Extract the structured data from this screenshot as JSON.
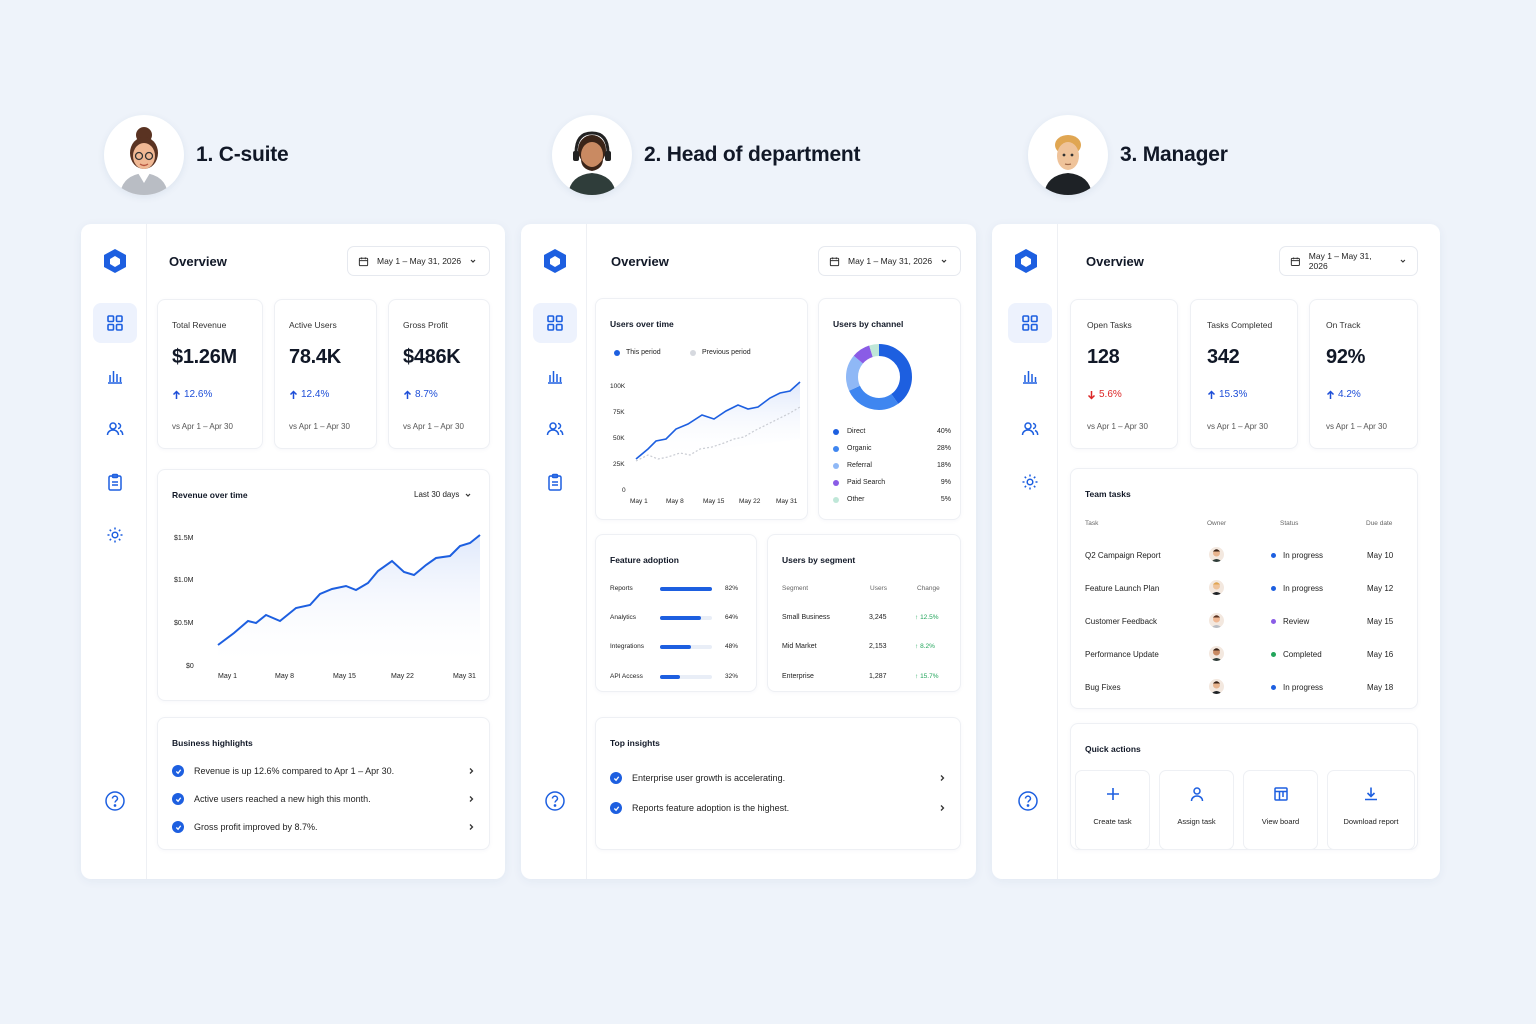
{
  "personas": [
    {
      "title": "1. C-suite"
    },
    {
      "title": "2. Head of department"
    },
    {
      "title": "3. Manager"
    }
  ],
  "csuite": {
    "overview": "Overview",
    "date_range": "May 1 – May 31, 2026",
    "kpis": [
      {
        "label": "Total Revenue",
        "value": "$1.26M",
        "change": "12.6%",
        "compare": "vs Apr 1 – Apr 30"
      },
      {
        "label": "Active Users",
        "value": "78.4K",
        "change": "12.4%",
        "compare": "vs Apr 1 – Apr 30"
      },
      {
        "label": "Gross Profit",
        "value": "$486K",
        "change": "8.7%",
        "compare": "vs Apr 1 – Apr 30"
      }
    ],
    "revenue_chart": {
      "title": "Revenue over time",
      "range_label": "Last 30 days",
      "y_ticks": [
        "$1.5M",
        "$1.0M",
        "$0.5M",
        "$0"
      ],
      "x_ticks": [
        "May 1",
        "May 8",
        "May 15",
        "May 22",
        "May 31"
      ]
    },
    "highlights": {
      "title": "Business highlights",
      "items": [
        "Revenue is up 12.6% compared to Apr 1 – Apr 30.",
        "Active users reached a new high this month.",
        "Gross profit improved by 8.7%."
      ]
    }
  },
  "head": {
    "overview": "Overview",
    "date_range": "May 1 – May 31, 2026",
    "users_chart": {
      "title": "Users over time",
      "legend_this": "This period",
      "legend_prev": "Previous period",
      "y_ticks": [
        "100K",
        "75K",
        "50K",
        "25K",
        "0"
      ],
      "x_ticks": [
        "May 1",
        "May 8",
        "May 15",
        "May 22",
        "May 31"
      ]
    },
    "channel": {
      "title": "Users by channel",
      "items": [
        {
          "name": "Direct",
          "pct": "40%",
          "color": "#1d5fe0"
        },
        {
          "name": "Organic",
          "pct": "28%",
          "color": "#3f86f0"
        },
        {
          "name": "Referral",
          "pct": "18%",
          "color": "#8fb8f6"
        },
        {
          "name": "Paid Search",
          "pct": "9%",
          "color": "#8a5ce6"
        },
        {
          "name": "Other",
          "pct": "5%",
          "color": "#bfe7d8"
        }
      ]
    },
    "adoption": {
      "title": "Feature adoption",
      "items": [
        {
          "name": "Reports",
          "pct": "82%"
        },
        {
          "name": "Analytics",
          "pct": "64%"
        },
        {
          "name": "Integrations",
          "pct": "48%"
        },
        {
          "name": "API Access",
          "pct": "32%"
        }
      ]
    },
    "segment": {
      "title": "Users by segment",
      "headers": [
        "Segment",
        "Users",
        "Change"
      ],
      "rows": [
        {
          "name": "Small Business",
          "users": "3,245",
          "change": "12.5%"
        },
        {
          "name": "Mid Market",
          "users": "2,153",
          "change": "8.2%"
        },
        {
          "name": "Enterprise",
          "users": "1,287",
          "change": "15.7%"
        }
      ]
    },
    "insights": {
      "title": "Top insights",
      "items": [
        "Enterprise user growth is accelerating.",
        "Reports feature adoption is the highest."
      ]
    }
  },
  "manager": {
    "overview": "Overview",
    "date_range": "May 1 – May 31, 2026",
    "kpis": [
      {
        "label": "Open Tasks",
        "value": "128",
        "change": "5.6%",
        "compare": "vs Apr 1 – Apr 30"
      },
      {
        "label": "Tasks Completed",
        "value": "342",
        "change": "15.3%",
        "compare": "vs Apr 1 – Apr 30"
      },
      {
        "label": "On Track",
        "value": "92%",
        "change": "4.2%",
        "compare": "vs Apr 1 – Apr 30"
      }
    ],
    "tasks": {
      "title": "Team tasks",
      "headers": [
        "Task",
        "Owner",
        "Status",
        "Due date"
      ],
      "rows": [
        {
          "task": "Q2 Campaign Report",
          "status": "In progress",
          "status_color": "#1d5fe0",
          "due": "May 10"
        },
        {
          "task": "Feature Launch Plan",
          "status": "In progress",
          "status_color": "#1d5fe0",
          "due": "May 12"
        },
        {
          "task": "Customer Feedback",
          "status": "Review",
          "status_color": "#8a5ce6",
          "due": "May 15"
        },
        {
          "task": "Performance Update",
          "status": "Completed",
          "status_color": "#22a55b",
          "due": "May 16"
        },
        {
          "task": "Bug Fixes",
          "status": "In progress",
          "status_color": "#1d5fe0",
          "due": "May 18"
        }
      ]
    },
    "quick": {
      "title": "Quick actions",
      "items": [
        "Create task",
        "Assign task",
        "View board",
        "Download report"
      ]
    }
  }
}
